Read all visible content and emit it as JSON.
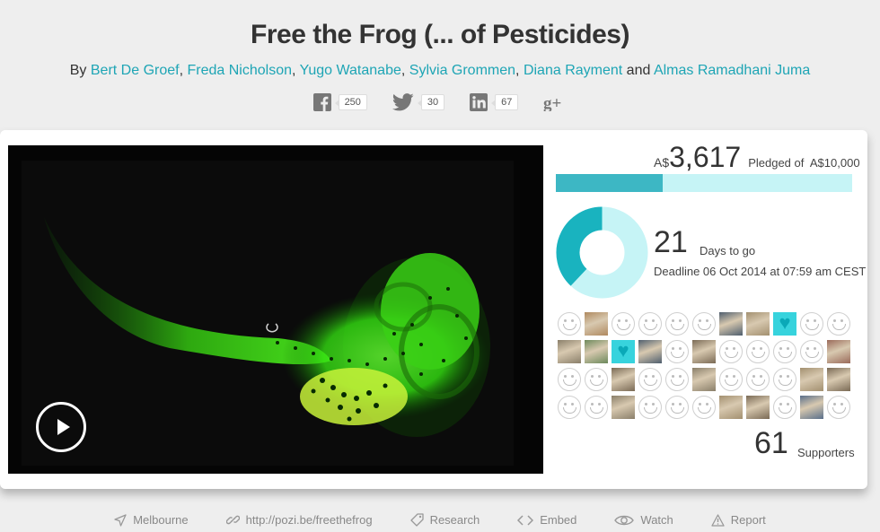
{
  "project": {
    "title": "Free the Frog (... of Pesticides)",
    "by_label": "By",
    "authors": [
      "Bert De Groef",
      "Freda Nicholson",
      "Yugo Watanabe",
      "Sylvia Grommen",
      "Diana Rayment",
      "Almas Ramadhani Juma"
    ],
    "separator": ",",
    "and_label": "and"
  },
  "social": {
    "facebook": {
      "icon": "facebook-icon",
      "count": "250"
    },
    "twitter": {
      "icon": "twitter-icon",
      "count": "30"
    },
    "linkedin": {
      "icon": "linkedin-icon",
      "count": "67"
    },
    "googleplus": {
      "icon": "google-plus-icon"
    }
  },
  "funding": {
    "currency": "A$",
    "pledged": "3,617",
    "pledged_label": "Pledged of",
    "goal": "A$10,000",
    "progress_fraction": 0.3617,
    "days": "21",
    "days_label": "Days to go",
    "deadline": "Deadline 06 Oct 2014 at 07:59 am CEST",
    "days_elapsed_fraction": 0.38,
    "supporters": "61",
    "supporters_label": "Supporters"
  },
  "supporters_grid": [
    "smiley",
    "photo",
    "smiley",
    "smiley",
    "smiley",
    "smiley",
    "photo",
    "photo",
    "heart",
    "smiley",
    "smiley",
    "photo",
    "photo",
    "heart",
    "photo",
    "smiley",
    "photo",
    "smiley",
    "smiley",
    "smiley",
    "smiley",
    "photo",
    "smiley",
    "smiley",
    "photo",
    "smiley",
    "smiley",
    "photo",
    "smiley",
    "smiley",
    "smiley",
    "photo",
    "photo",
    "smiley",
    "smiley",
    "photo",
    "smiley",
    "smiley",
    "smiley",
    "photo",
    "photo",
    "smiley",
    "photo",
    "smiley"
  ],
  "footer": [
    {
      "icon": "location-icon",
      "label": "Melbourne"
    },
    {
      "icon": "link-icon",
      "label": "http://pozi.be/freethefrog"
    },
    {
      "icon": "tag-icon",
      "label": "Research"
    },
    {
      "icon": "code-icon",
      "label": "Embed"
    },
    {
      "icon": "eye-icon",
      "label": "Watch"
    },
    {
      "icon": "warning-icon",
      "label": "Report"
    }
  ],
  "colors": {
    "accent": "#1ea5b5",
    "bar_fill": "#3db7c4",
    "bar_bg": "#c6f4f6",
    "donut_main": "#19b3bf",
    "donut_light": "#c6f4f6"
  }
}
